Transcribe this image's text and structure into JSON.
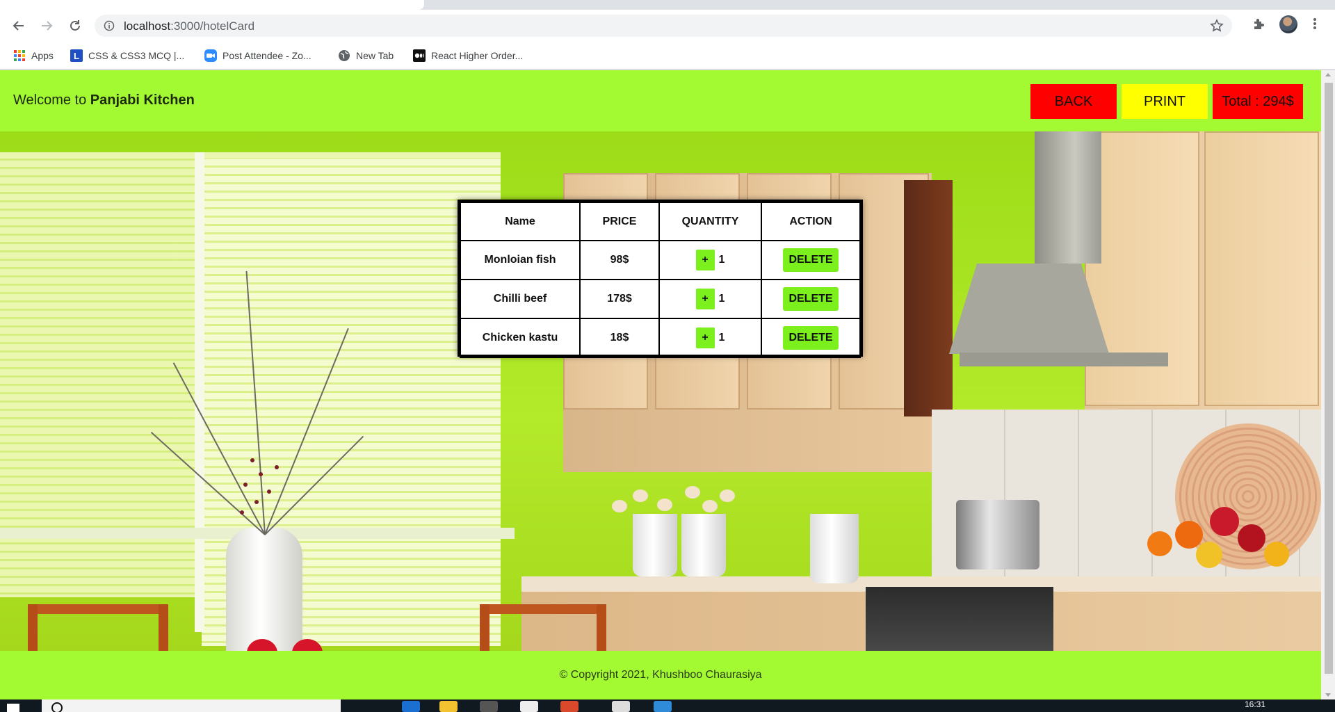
{
  "browser": {
    "url_host": "localhost",
    "url_path": ":3000/hotelCard",
    "bookmarks": [
      {
        "label": "Apps",
        "icon": "apps-grid-icon"
      },
      {
        "label": "CSS & CSS3 MCQ |...",
        "icon": "l-badge-icon"
      },
      {
        "label": "Post Attendee - Zo...",
        "icon": "zoom-icon"
      },
      {
        "label": "New Tab",
        "icon": "globe-icon"
      },
      {
        "label": "React Higher Order...",
        "icon": "medium-icon"
      }
    ]
  },
  "header": {
    "welcome_prefix": "Welcome to",
    "restaurant_name": "Panjabi Kitchen",
    "back_label": "BACK",
    "print_label": "PRINT",
    "total_label": "Total : 294$"
  },
  "cart": {
    "columns": [
      "Name",
      "PRICE",
      "QUANTITY",
      "ACTION"
    ],
    "rows": [
      {
        "name": "Monloian fish",
        "price": "98$",
        "plus": "+",
        "quantity": "1",
        "action": "DELETE"
      },
      {
        "name": "Chilli beef",
        "price": "178$",
        "plus": "+",
        "quantity": "1",
        "action": "DELETE"
      },
      {
        "name": "Chicken kastu",
        "price": "18$",
        "plus": "+",
        "quantity": "1",
        "action": "DELETE"
      }
    ]
  },
  "footer": {
    "copyright": "© Copyright 2021, Khushboo Chaurasiya"
  },
  "taskbar": {
    "clock": "16:31"
  },
  "colors": {
    "header_bg": "#a3fa32",
    "back_bg": "#ff0000",
    "print_bg": "#ffff00",
    "total_bg": "#ff0000",
    "button_green": "#7bf01c"
  }
}
